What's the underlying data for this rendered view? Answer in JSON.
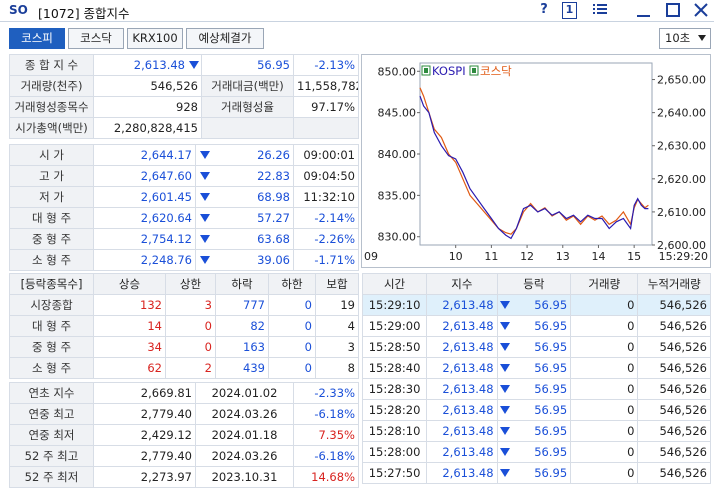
{
  "window": {
    "logo": "SO",
    "title": "[1072] 종합지수",
    "help": "?",
    "num": "1"
  },
  "tabs": [
    "코스피",
    "코스닥",
    "KRX100",
    "예상체결가"
  ],
  "interval": "10초",
  "summary": {
    "r1": {
      "label": "종 합 지 수",
      "value": "2,613.48",
      "change": "56.95",
      "rate": "-2.13%"
    },
    "r2": {
      "label1": "거래량(천주)",
      "value1": "546,526",
      "label2": "거래대금(백만)",
      "value2": "11,558,782"
    },
    "r3": {
      "label1": "거래형성종목수",
      "value1": "928",
      "label2": "거래형성율",
      "value2": "97.17%"
    },
    "r4": {
      "label": "시가총액(백만)",
      "value": "2,280,828,415"
    }
  },
  "prices": [
    {
      "label": "시   가",
      "value": "2,644.17",
      "change": "26.26",
      "extra": "09:00:01"
    },
    {
      "label": "고   가",
      "value": "2,647.60",
      "change": "22.83",
      "extra": "09:04:50"
    },
    {
      "label": "저   가",
      "value": "2,601.45",
      "change": "68.98",
      "extra": "11:32:10"
    },
    {
      "label": "대 형 주",
      "value": "2,620.64",
      "change": "57.27",
      "extra": "-2.14%"
    },
    {
      "label": "중 형 주",
      "value": "2,754.12",
      "change": "63.68",
      "extra": "-2.26%"
    },
    {
      "label": "소 형 주",
      "value": "2,248.76",
      "change": "39.06",
      "extra": "-1.71%"
    }
  ],
  "breadth": {
    "headers": [
      "[등락종목수]",
      "상승",
      "상한",
      "하락",
      "하한",
      "보합"
    ],
    "rows": [
      {
        "label": "시장종합",
        "up": "132",
        "uplim": "3",
        "down": "777",
        "downlim": "0",
        "flat": "19"
      },
      {
        "label": "대 형 주",
        "up": "14",
        "uplim": "0",
        "down": "82",
        "downlim": "0",
        "flat": "4"
      },
      {
        "label": "중 형 주",
        "up": "34",
        "uplim": "0",
        "down": "163",
        "downlim": "0",
        "flat": "3"
      },
      {
        "label": "소 형 주",
        "up": "62",
        "uplim": "2",
        "down": "439",
        "downlim": "0",
        "flat": "8"
      }
    ]
  },
  "yearly": [
    {
      "label": "연초  지수",
      "value": "2,669.81",
      "date": "2024.01.02",
      "rate": "-2.33%"
    },
    {
      "label": "연중  최고",
      "value": "2,779.40",
      "date": "2024.03.26",
      "rate": "-6.18%"
    },
    {
      "label": "연중  최저",
      "value": "2,429.12",
      "date": "2024.01.18",
      "rate": "7.35%"
    },
    {
      "label": "52 주 최고",
      "value": "2,779.40",
      "date": "2024.03.26",
      "rate": "-6.18%"
    },
    {
      "label": "52 주 최저",
      "value": "2,273.97",
      "date": "2023.10.31",
      "rate": "14.68%"
    }
  ],
  "ticks": {
    "headers": [
      "시간",
      "지수",
      "등락",
      "거래량",
      "누적거래량"
    ],
    "rows": [
      {
        "time": "15:29:10",
        "index": "2,613.48",
        "change": "56.95",
        "vol": "0",
        "cum": "546,526"
      },
      {
        "time": "15:29:00",
        "index": "2,613.48",
        "change": "56.95",
        "vol": "0",
        "cum": "546,526"
      },
      {
        "time": "15:28:50",
        "index": "2,613.48",
        "change": "56.95",
        "vol": "0",
        "cum": "546,526"
      },
      {
        "time": "15:28:40",
        "index": "2,613.48",
        "change": "56.95",
        "vol": "0",
        "cum": "546,526"
      },
      {
        "time": "15:28:30",
        "index": "2,613.48",
        "change": "56.95",
        "vol": "0",
        "cum": "546,526"
      },
      {
        "time": "15:28:20",
        "index": "2,613.48",
        "change": "56.95",
        "vol": "0",
        "cum": "546,526"
      },
      {
        "time": "15:28:10",
        "index": "2,613.48",
        "change": "56.95",
        "vol": "0",
        "cum": "546,526"
      },
      {
        "time": "15:28:00",
        "index": "2,613.48",
        "change": "56.95",
        "vol": "0",
        "cum": "546,526"
      },
      {
        "time": "15:27:50",
        "index": "2,613.48",
        "change": "56.95",
        "vol": "0",
        "cum": "546,526"
      }
    ]
  },
  "chart_data": {
    "type": "line",
    "legend": [
      "KOSPI",
      "코스닥"
    ],
    "left_ticks": [
      "850.00",
      "845.00",
      "840.00",
      "835.00",
      "830.00"
    ],
    "right_ticks": [
      "2,650.00",
      "2,640.00",
      "2,630.00",
      "2,620.00",
      "2,610.00",
      "2,600.00"
    ],
    "x_ticks": [
      "09",
      "10",
      "11",
      "12",
      "13",
      "14",
      "15",
      "15:29:20"
    ],
    "left_range": [
      829,
      851
    ],
    "right_range": [
      2600,
      2655
    ],
    "series": [
      {
        "name": "KOSPI",
        "color": "#2a1bb0",
        "axis": "right",
        "x": [
          9.0,
          9.1,
          9.25,
          9.4,
          9.6,
          9.8,
          10.0,
          10.2,
          10.4,
          10.6,
          10.8,
          11.0,
          11.2,
          11.4,
          11.55,
          11.7,
          11.9,
          12.1,
          12.3,
          12.5,
          12.7,
          12.9,
          13.1,
          13.3,
          13.5,
          13.7,
          13.9,
          14.1,
          14.3,
          14.5,
          14.7,
          14.9,
          15.0,
          15.1,
          15.2,
          15.3,
          15.4
        ],
        "y": [
          2645,
          2642,
          2640,
          2634,
          2630,
          2627,
          2626,
          2622,
          2617,
          2614,
          2611,
          2608,
          2605,
          2603,
          2602,
          2605,
          2611,
          2612,
          2610,
          2611,
          2609,
          2610,
          2608,
          2609,
          2607,
          2609,
          2608,
          2608,
          2605,
          2607,
          2608,
          2605,
          2612,
          2614,
          2612,
          2611,
          2611
        ]
      },
      {
        "name": "코스닥",
        "color": "#e05a14",
        "axis": "left",
        "x": [
          9.0,
          9.1,
          9.25,
          9.4,
          9.6,
          9.8,
          10.0,
          10.2,
          10.4,
          10.6,
          10.8,
          11.0,
          11.2,
          11.4,
          11.55,
          11.7,
          11.9,
          12.1,
          12.3,
          12.5,
          12.7,
          12.9,
          13.1,
          13.3,
          13.5,
          13.7,
          13.9,
          14.1,
          14.3,
          14.5,
          14.7,
          14.9,
          15.0,
          15.1,
          15.2,
          15.3,
          15.4
        ],
        "y": [
          848,
          847,
          845,
          843,
          842,
          840,
          839,
          837,
          835,
          834,
          833,
          832,
          831,
          830.5,
          830.3,
          831,
          833,
          834,
          833,
          833.5,
          832.5,
          833,
          832,
          832.5,
          831.5,
          832.5,
          832,
          832.5,
          831.5,
          832,
          833,
          831.5,
          833.5,
          834.5,
          834,
          833.5,
          833.8
        ]
      }
    ]
  }
}
